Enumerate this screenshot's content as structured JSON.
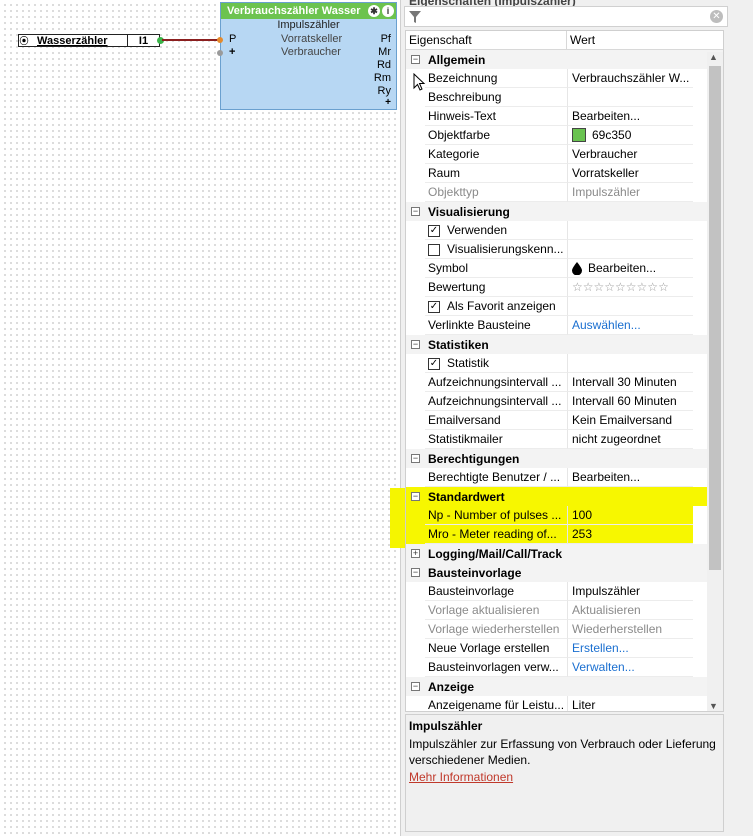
{
  "canvas": {
    "input_node": {
      "name": "Wasserzähler",
      "port": "I1"
    },
    "block": {
      "title": "Verbrauchszähler Wasser",
      "subtitle": "Impulszähler",
      "input_p": "P",
      "input_plus": "+",
      "label1": "Vorratskeller",
      "label2": "Verbraucher",
      "outputs": [
        "Pf",
        "Mr",
        "Rd",
        "Rm",
        "Ry"
      ],
      "plus_bottom": "+"
    }
  },
  "panel": {
    "title": "Eigenschaften (Impulszähler)",
    "columns": {
      "property": "Eigenschaft",
      "value": "Wert"
    },
    "highlight_color": "#f5f500",
    "sections": [
      {
        "title": "Allgemein",
        "expander": "⊟",
        "rows": [
          {
            "key": "Bezeichnung",
            "value": "Verbrauchszähler W..."
          },
          {
            "key": "Beschreibung",
            "value": ""
          },
          {
            "key": "Hinweis-Text",
            "value": "Bearbeiten..."
          },
          {
            "key": "Objektfarbe",
            "value": "69c350",
            "swatch": "#69c350"
          },
          {
            "key": "Kategorie",
            "value": "Verbraucher"
          },
          {
            "key": "Raum",
            "value": "Vorratskeller"
          },
          {
            "key": "Objekttyp",
            "value": "Impulszähler",
            "disabled": true
          }
        ]
      },
      {
        "title": "Visualisierung",
        "expander": "⊟",
        "rows": [
          {
            "key": "Verwenden",
            "value": "",
            "checkbox": true,
            "checked": true
          },
          {
            "key": "Visualisierungskenn...",
            "value": "",
            "checkbox": true,
            "checked": false
          },
          {
            "key": "Symbol",
            "value": "Bearbeiten...",
            "icon": "water-drop-icon"
          },
          {
            "key": "Bewertung",
            "value": "☆☆☆☆☆☆☆☆☆",
            "icon": "star-rating"
          },
          {
            "key": "Als Favorit anzeigen",
            "value": "",
            "checkbox": true,
            "checked": true
          },
          {
            "key": "Verlinkte Bausteine",
            "value": "Auswählen...",
            "link": true
          }
        ]
      },
      {
        "title": "Statistiken",
        "expander": "⊟",
        "rows": [
          {
            "key": "Statistik",
            "value": "",
            "checkbox": true,
            "checked": true
          },
          {
            "key": "Aufzeichnungsintervall ...",
            "value": "Intervall 30 Minuten"
          },
          {
            "key": "Aufzeichnungsintervall ...",
            "value": "Intervall 60 Minuten"
          },
          {
            "key": "Emailversand",
            "value": "Kein Emailversand"
          },
          {
            "key": "Statistikmailer",
            "value": "nicht zugeordnet"
          }
        ]
      },
      {
        "title": "Berechtigungen",
        "expander": "⊟",
        "rows": [
          {
            "key": "Berechtigte Benutzer / ...",
            "value": "Bearbeiten..."
          }
        ]
      },
      {
        "title": "Standardwert",
        "expander": "⊟",
        "highlight": true,
        "rows": [
          {
            "key": "Np - Number of pulses ...",
            "value": "100"
          },
          {
            "key": "Mro - Meter reading of...",
            "value": "253"
          }
        ]
      },
      {
        "title": "Logging/Mail/Call/Track",
        "expander": "⊞",
        "rows": []
      },
      {
        "title": "Bausteinvorlage",
        "expander": "⊟",
        "rows": [
          {
            "key": "Bausteinvorlage",
            "value": "Impulszähler"
          },
          {
            "key": "Vorlage aktualisieren",
            "value": "Aktualisieren",
            "disabled": true
          },
          {
            "key": "Vorlage wiederherstellen",
            "value": "Wiederherstellen",
            "disabled": true
          },
          {
            "key": "Neue Vorlage erstellen",
            "value": "Erstellen...",
            "link": true
          },
          {
            "key": "Bausteinvorlagen verw...",
            "value": "Verwalten...",
            "link": true
          }
        ]
      },
      {
        "title": "Anzeige",
        "expander": "⊟",
        "rows": [
          {
            "key": "Anzeigename für Leistu...",
            "value": "Liter"
          }
        ]
      }
    ],
    "description": {
      "title": "Impulszähler",
      "text": "Impulszähler zur Erfassung von Verbrauch oder Lieferung verschiedener Medien.",
      "more": "Mehr Informationen"
    }
  }
}
